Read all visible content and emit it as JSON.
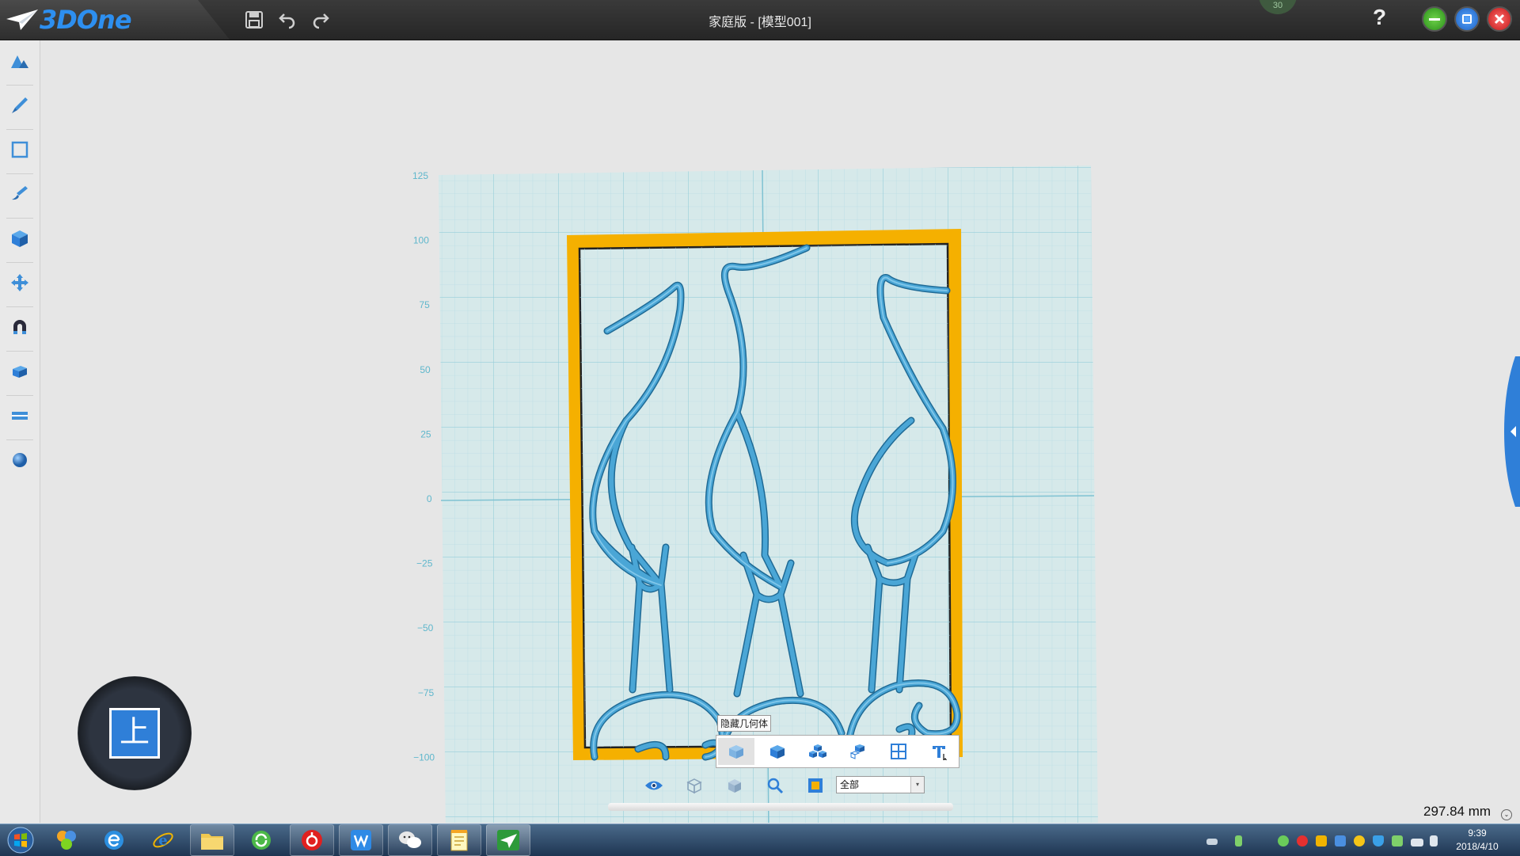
{
  "app": {
    "logo_text": "3DOne",
    "window_title": "家庭版 - [模型001]",
    "help_label": "?",
    "corner_badge": "30"
  },
  "axis": {
    "y_ticks": [
      "125",
      "100",
      "75",
      "50",
      "25",
      "0",
      "−25",
      "−50",
      "−75",
      "−100"
    ]
  },
  "viewcube": {
    "face_label": "上"
  },
  "minibar": {
    "tooltip": "隐藏几何体",
    "items": [
      "hide-geometry",
      "show-geometry",
      "show-all",
      "isolate",
      "grid",
      "text"
    ]
  },
  "bottombar": {
    "filter_value": "全部",
    "filter_arrow": "▾"
  },
  "measurement": {
    "value": "297.84 mm",
    "dropdown": "⌄"
  },
  "taskbar": {
    "clock_time": "9:39",
    "clock_date": "2018/4/10"
  },
  "colors": {
    "grid_bg": "#d6e8ea",
    "grid_line": "#9fd3dd",
    "frame": "#f5b000",
    "model": "#3d97c6",
    "accent": "#2f7fd8"
  }
}
